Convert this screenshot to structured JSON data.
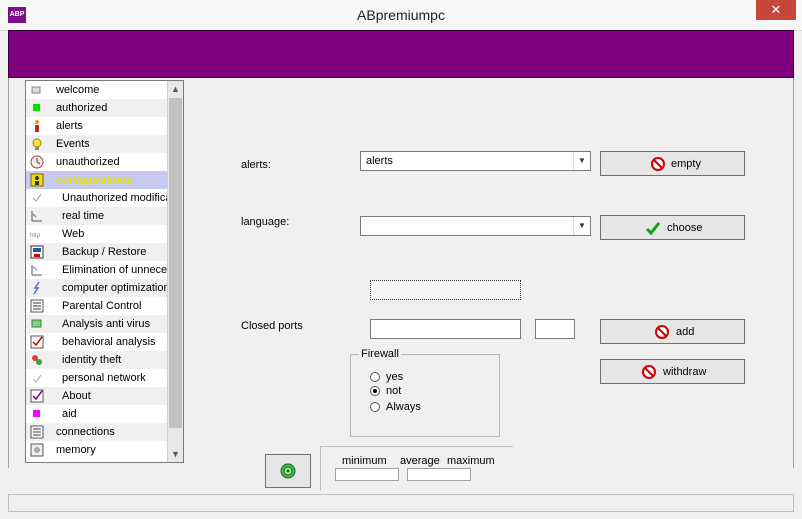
{
  "window": {
    "title": "ABpremiumpc",
    "icon_text": "ABP",
    "close_glyph": "✕",
    "banner_color": "#800080"
  },
  "sidebar": {
    "items": [
      {
        "label": "welcome",
        "icon": "welcome-icon"
      },
      {
        "label": "authorized",
        "icon": "green-square-icon"
      },
      {
        "label": "alerts",
        "icon": "alert-person-icon"
      },
      {
        "label": "Events",
        "icon": "lightbulb-icon"
      },
      {
        "label": "unauthorized",
        "icon": "clock-icon"
      },
      {
        "label": "configurations",
        "icon": "config-person-icon"
      },
      {
        "label": "Unauthorized modifications",
        "icon": "check-mark-icon"
      },
      {
        "label": "real time",
        "icon": "realtime-icon"
      },
      {
        "label": "Web",
        "icon": "http-icon"
      },
      {
        "label": "Backup / Restore",
        "icon": "backup-icon"
      },
      {
        "label": "Elimination of unnecessary",
        "icon": "elimination-icon"
      },
      {
        "label": "computer optimization",
        "icon": "lightning-icon"
      },
      {
        "label": "Parental Control",
        "icon": "list-icon"
      },
      {
        "label": "Analysis anti virus",
        "icon": "green-box-icon"
      },
      {
        "label": "behavioral analysis",
        "icon": "red-check-icon"
      },
      {
        "label": "identity theft",
        "icon": "identity-icon"
      },
      {
        "label": "personal network",
        "icon": "network-icon"
      },
      {
        "label": "About",
        "icon": "purple-check-icon"
      },
      {
        "label": "aid",
        "icon": "magenta-square-icon"
      },
      {
        "label": "connections",
        "icon": "connections-icon"
      },
      {
        "label": "memory",
        "icon": "memory-icon"
      }
    ]
  },
  "form": {
    "alerts_label": "alerts:",
    "alerts_value": "alerts",
    "empty_button": "empty",
    "language_label": "language:",
    "language_value": "",
    "choose_button": "choose",
    "closed_ports_label": "Closed ports",
    "add_button": "add",
    "withdraw_button": "withdraw",
    "firewall": {
      "legend": "Firewall",
      "options": [
        "yes",
        "not",
        "Always"
      ],
      "selected": "not"
    }
  },
  "stats": {
    "minimum": "minimum",
    "average": "average",
    "maximum": "maximum"
  }
}
